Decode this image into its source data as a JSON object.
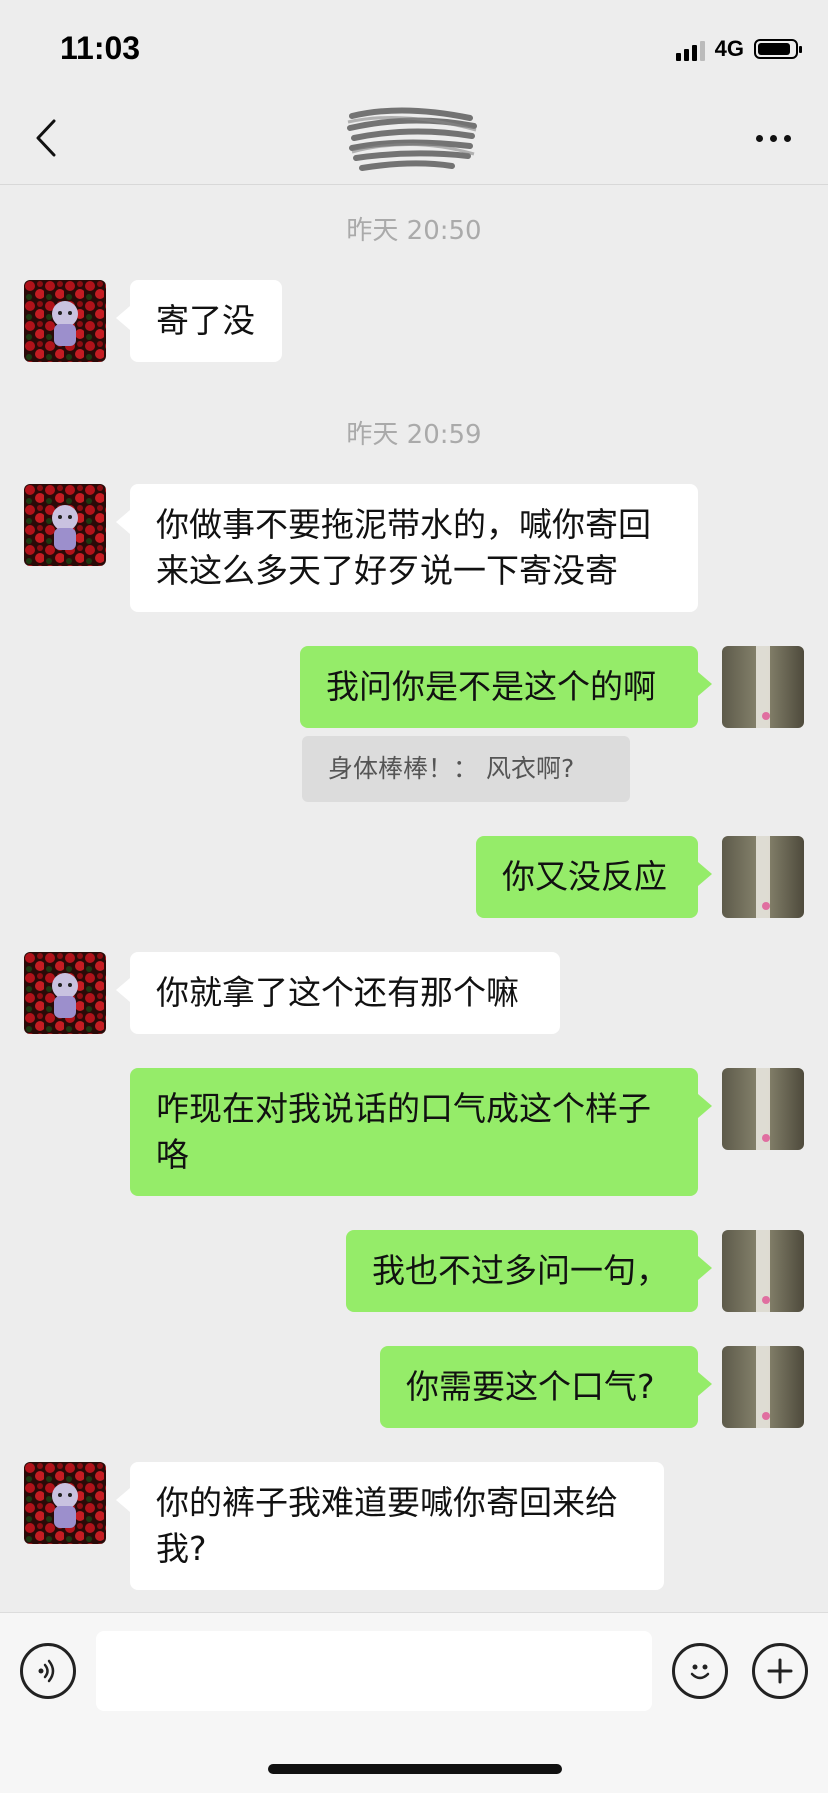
{
  "status_bar": {
    "time": "11:03",
    "network": "4G"
  },
  "nav": {
    "back_icon": "chevron-left-icon",
    "title_obscured": true,
    "more_icon": "more-dots-icon"
  },
  "timestamps": [
    "昨天 20:50",
    "昨天 20:59"
  ],
  "messages": [
    {
      "side": "left",
      "text": "寄了没"
    },
    {
      "side": "left",
      "text": "你做事不要拖泥带水的，喊你寄回来这么多天了好歹说一下寄没寄"
    },
    {
      "side": "right",
      "text": "我问你是不是这个的啊"
    },
    {
      "side": "right",
      "text": "你又没反应"
    },
    {
      "side": "left",
      "text": "你就拿了这个还有那个嘛"
    },
    {
      "side": "right",
      "text": "咋现在对我说话的口气成这个样子咯"
    },
    {
      "side": "right",
      "text": "我也不过多问一句，"
    },
    {
      "side": "right",
      "text": "你需要这个口气?"
    },
    {
      "side": "left",
      "text": "你的裤子我难道要喊你寄回来给我?"
    }
  ],
  "quote": {
    "text": "身体棒棒！： 风衣啊?"
  },
  "input_bar": {
    "voice_icon": "voice-icon",
    "placeholder": "",
    "emoji_icon": "emoji-icon",
    "plus_icon": "plus-icon"
  },
  "colors": {
    "background": "#ededed",
    "sent_bubble": "#95ec69",
    "received_bubble": "#ffffff"
  }
}
